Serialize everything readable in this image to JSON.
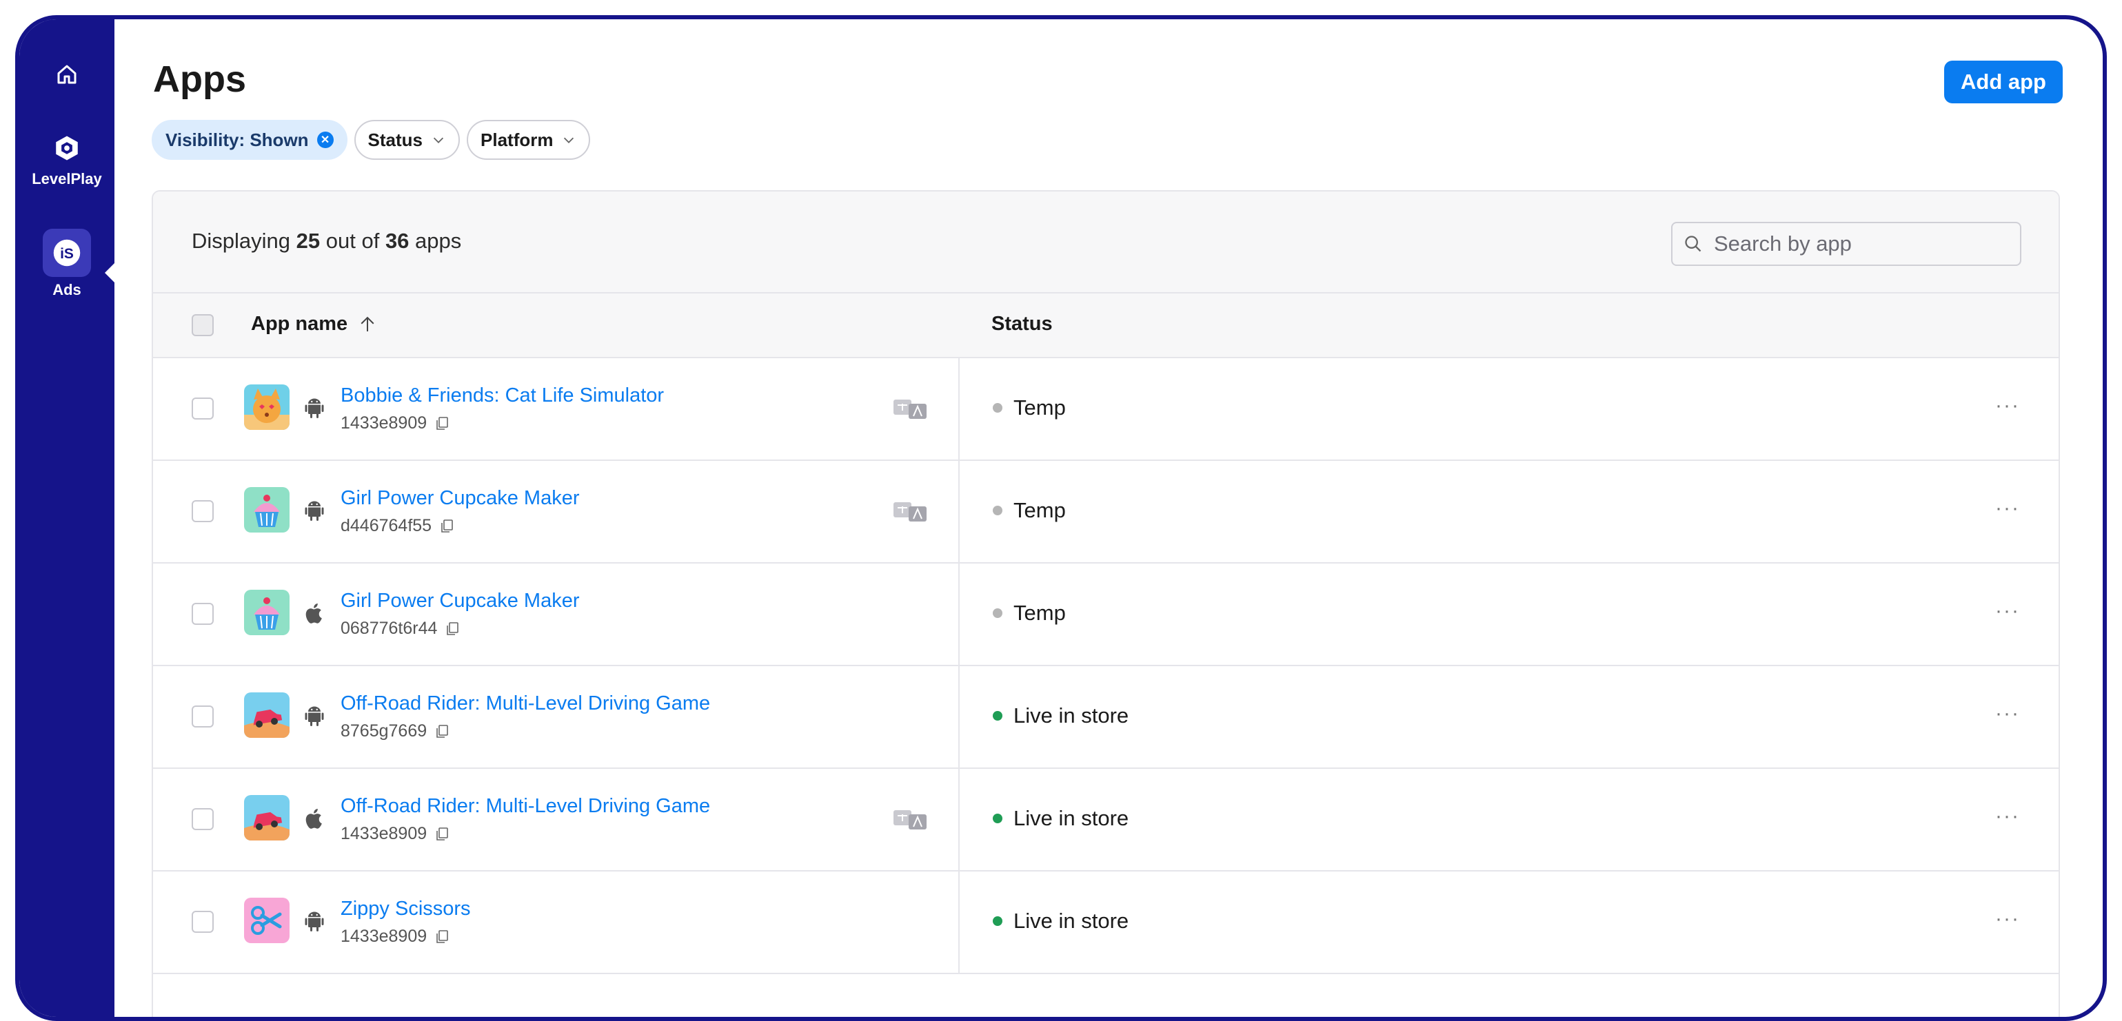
{
  "sidebar": {
    "items": [
      {
        "icon": "home-icon",
        "label": ""
      },
      {
        "icon": "levelplay-icon",
        "label": "LevelPlay"
      },
      {
        "icon": "ads-icon",
        "label": "Ads",
        "badge": "iS"
      }
    ]
  },
  "header": {
    "title": "Apps",
    "add_button": "Add app"
  },
  "filters": [
    {
      "label": "Visibility: Shown",
      "active": true,
      "clearable": true
    },
    {
      "label": "Status",
      "active": false
    },
    {
      "label": "Platform",
      "active": false
    }
  ],
  "table": {
    "count": {
      "prefix": "Displaying",
      "shown": "25",
      "middle": "out of",
      "total": "36",
      "suffix": "apps"
    },
    "search_placeholder": "Search by app",
    "columns": {
      "app_name": "App name",
      "status": "Status"
    },
    "rows": [
      {
        "name": "Bobbie & Friends: Cat Life Simulator",
        "id": "1433e8909",
        "platform": "android",
        "icon": "cat-app-icon",
        "lang": true,
        "status": "Temp",
        "status_color": "#b5b5b5"
      },
      {
        "name": "Girl Power Cupcake Maker",
        "id": "d446764f55",
        "platform": "android",
        "icon": "cupcake-app-icon",
        "lang": true,
        "status": "Temp",
        "status_color": "#b5b5b5"
      },
      {
        "name": "Girl Power Cupcake Maker",
        "id": "068776t6r44",
        "platform": "apple",
        "icon": "cupcake-app-icon",
        "lang": false,
        "status": "Temp",
        "status_color": "#b5b5b5"
      },
      {
        "name": "Off-Road Rider: Multi-Level Driving Game",
        "id": "8765g7669",
        "platform": "android",
        "icon": "car-app-icon",
        "lang": false,
        "status": "Live in store",
        "status_color": "#1f9d55"
      },
      {
        "name": "Off-Road Rider: Multi-Level Driving Game",
        "id": "1433e8909",
        "platform": "apple",
        "icon": "car-app-icon",
        "lang": true,
        "status": "Live in store",
        "status_color": "#1f9d55"
      },
      {
        "name": "Zippy Scissors",
        "id": "1433e8909",
        "platform": "android",
        "icon": "scissors-app-icon",
        "lang": false,
        "status": "Live in store",
        "status_color": "#1f9d55"
      }
    ],
    "row_menu": "···"
  },
  "colors": {
    "sidebar": "#15148a",
    "accent": "#0a7cf0",
    "live": "#1f9d55",
    "temp": "#b5b5b5"
  }
}
